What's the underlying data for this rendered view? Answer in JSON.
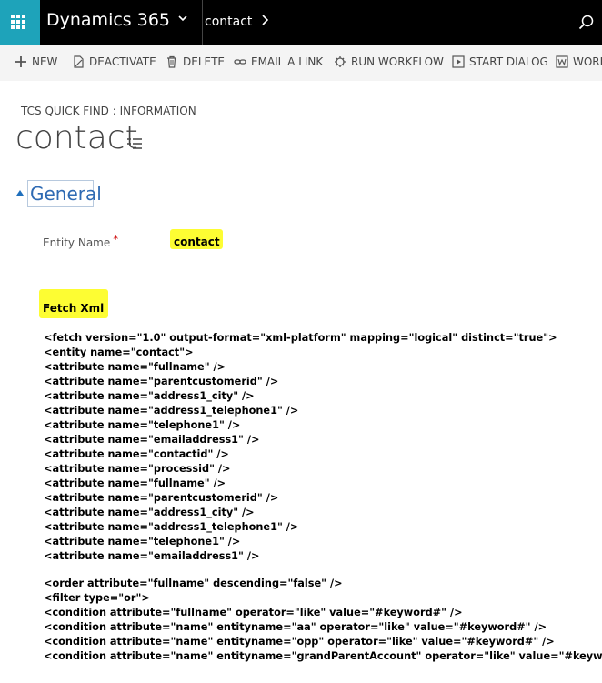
{
  "app": {
    "name": "Dynamics 365",
    "breadcrumb": "contact"
  },
  "toolbar": {
    "items": [
      {
        "label": "NEW",
        "icon": "plus-icon"
      },
      {
        "label": "DEACTIVATE",
        "icon": "document-icon"
      },
      {
        "label": "DELETE",
        "icon": "trash-icon"
      },
      {
        "label": "EMAIL A LINK",
        "icon": "link-icon"
      },
      {
        "label": "RUN WORKFLOW",
        "icon": "workflow-icon"
      },
      {
        "label": "START DIALOG",
        "icon": "play-icon"
      },
      {
        "label": "WORD",
        "icon": "word-icon"
      }
    ]
  },
  "record": {
    "subtitle": "TCS QUICK FIND : INFORMATION",
    "title": "contact"
  },
  "section": {
    "title": "General"
  },
  "fields": {
    "entity_name_label": "Entity Name",
    "required_marker": "*",
    "entity_name_value": "contact",
    "fetch_xml_label": "Fetch Xml"
  },
  "fetch_xml_lines": [
    "<fetch version=\"1.0\" output-format=\"xml-platform\" mapping=\"logical\" distinct=\"true\">",
    "<entity name=\"contact\">",
    "<attribute name=\"fullname\" />",
    "<attribute name=\"parentcustomerid\" />",
    "<attribute name=\"address1_city\" />",
    "<attribute name=\"address1_telephone1\" />",
    "<attribute name=\"telephone1\" />",
    "<attribute name=\"emailaddress1\" />",
    "<attribute name=\"contactid\" />",
    "<attribute name=\"processid\" />",
    "<attribute name=\"fullname\" />",
    "<attribute name=\"parentcustomerid\" />",
    "<attribute name=\"address1_city\" />",
    "<attribute name=\"address1_telephone1\" />",
    "<attribute name=\"telephone1\" />",
    "<attribute name=\"emailaddress1\" />",
    "",
    "<order attribute=\"fullname\" descending=\"false\" />",
    "<filter type=\"or\">",
    "<condition attribute=\"fullname\" operator=\"like\" value=\"#keyword#\" />",
    "<condition attribute=\"name\" entityname=\"aa\" operator=\"like\" value=\"#keyword#\" />",
    "<condition attribute=\"name\" entityname=\"opp\" operator=\"like\" value=\"#keyword#\" />",
    "<condition attribute=\"name\" entityname=\"grandParentAccount\" operator=\"like\" value=\"#keyword#\" />"
  ],
  "colors": {
    "accent": "#1ea3ba",
    "topbar": "#000000",
    "highlight": "#fdfd33",
    "section_title": "#2e6ab3"
  }
}
